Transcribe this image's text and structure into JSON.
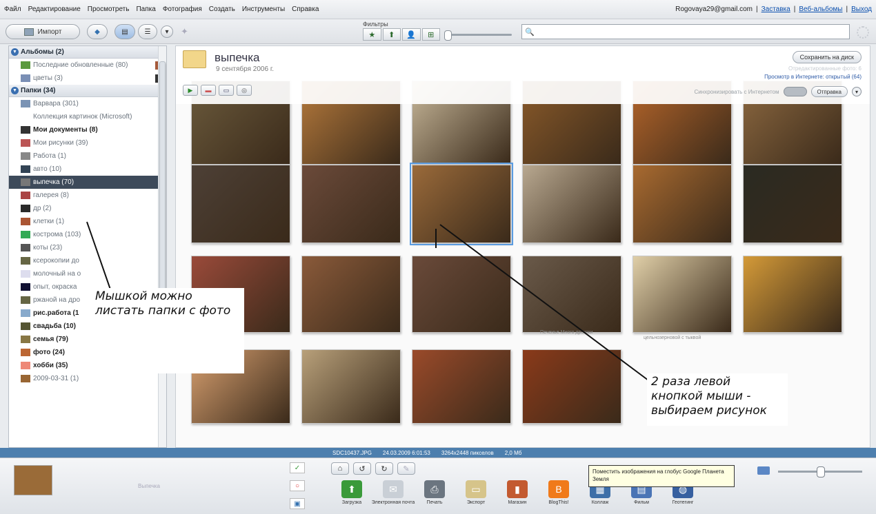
{
  "menu": {
    "items": [
      "Файл",
      "Редактирование",
      "Просмотреть",
      "Папка",
      "Фотография",
      "Создать",
      "Инструменты",
      "Справка"
    ],
    "email": "Rogovaya29@gmail.com",
    "sep": "|",
    "links": [
      "Заставка",
      "Веб-альбомы",
      "Выход"
    ]
  },
  "toolbar": {
    "import_label": "Импорт",
    "filters_label": "Фильтры",
    "filter_icons": [
      "★",
      "⬆",
      "👤",
      "⊞"
    ],
    "search_icon": "🔍"
  },
  "sidebar": {
    "albums_header": "Альбомы (2)",
    "albums": [
      {
        "label": "Последние обновленные (80)"
      },
      {
        "label": "цветы (3)"
      }
    ],
    "folders_header": "Папки (34)",
    "folders": [
      {
        "label": "Варвара (301)"
      },
      {
        "label": "Коллекция картинок (Microsoft)"
      },
      {
        "label": "Мои документы (8)",
        "bold": true
      },
      {
        "label": "Мои рисунки (39)"
      },
      {
        "label": "Работа (1)"
      },
      {
        "label": "авто (10)"
      },
      {
        "label": "выпечка (70)",
        "selected": true
      },
      {
        "label": "галерея (8)"
      },
      {
        "label": "др (2)"
      },
      {
        "label": "клетки (1)"
      },
      {
        "label": "кострома (103)"
      },
      {
        "label": "коты (23)"
      },
      {
        "label": "ксерокопии до"
      },
      {
        "label": "молочный на о"
      },
      {
        "label": "опыт, окраска"
      },
      {
        "label": "ржаной на дро"
      },
      {
        "label": "рис.работа (1",
        "bold": true
      },
      {
        "label": "свадьба (10)",
        "bold": true
      },
      {
        "label": "семья (79)",
        "bold": true
      },
      {
        "label": "фото (24)",
        "bold": true
      },
      {
        "label": "хобби (35)",
        "bold": true
      },
      {
        "label": "2009-03-31 (1)"
      }
    ]
  },
  "album": {
    "title": "выпечка",
    "date": "9 сентября 2006 г.",
    "save_disk": "Сохранить на диск",
    "right_line_1": "Отредактированные фото: 6",
    "right_line_2": "Просмотр в Интернете: открытый (64)",
    "sync_label": "Синхронизировать с Интернетом",
    "send_label": "Отправка"
  },
  "captions": [
    "Печенье Много дрожжи",
    "цельнозерновой с тыквой"
  ],
  "status": {
    "filename": "SDC10437.JPG",
    "datetime": "24.03.2009 6:01:53",
    "dimensions": "3264x2448 пикселов",
    "size": "2,0 Мб"
  },
  "tray": {
    "label": "Выпечка",
    "actions": [
      {
        "label": "Загрузка",
        "icon": "⬆",
        "color": "#3a9a3a"
      },
      {
        "label": "Электронная почта",
        "icon": "✉",
        "color": "#c9cfd6"
      },
      {
        "label": "Печать",
        "icon": "⎙",
        "color": "#6b7580"
      },
      {
        "label": "Экспорт",
        "icon": "▭",
        "color": "#d6c48a"
      },
      {
        "label": "Магазин",
        "icon": "▮",
        "color": "#c35a30"
      },
      {
        "label": "BlogThis!",
        "icon": "B",
        "color": "#f07a1a"
      },
      {
        "label": "Коллаж",
        "icon": "▦",
        "color": "#3d6fa8"
      },
      {
        "label": "Фильм",
        "icon": "▤",
        "color": "#4a74b5"
      },
      {
        "label": "Геотегинг",
        "icon": "◍",
        "color": "#3760a0"
      }
    ],
    "tooltip": "Поместить изображения на глобус Google Планета Земля"
  },
  "annotations": {
    "note_left": "Мышкой можно листать папки с фото",
    "note_right": "2 раза левой кнопкой мыши - выбираем рисунок"
  }
}
